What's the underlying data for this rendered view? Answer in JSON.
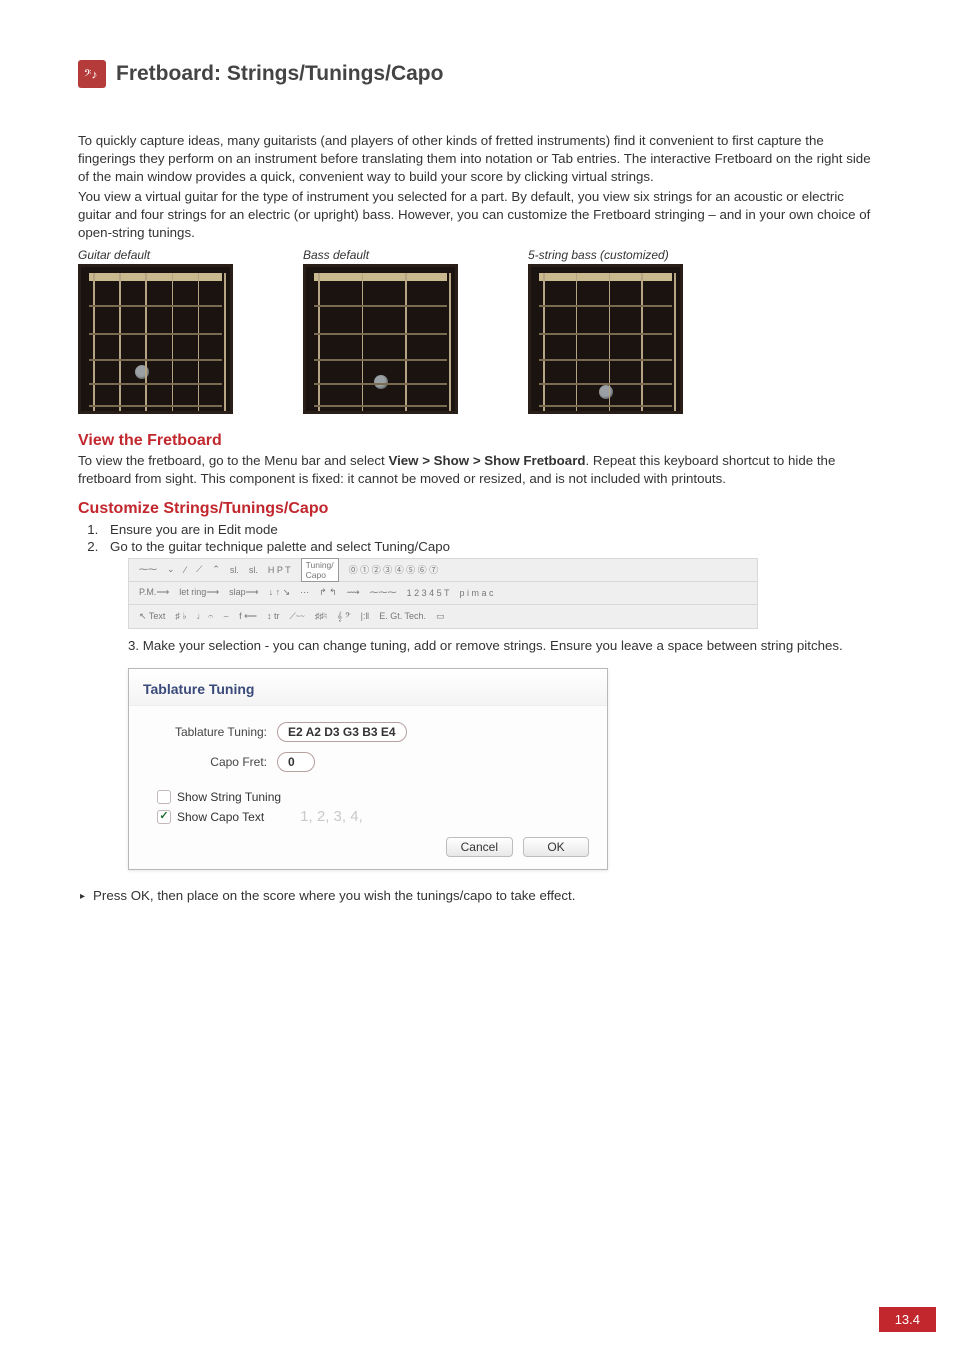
{
  "page": {
    "title": "Fretboard: Strings/Tunings/Capo",
    "number": "13.4"
  },
  "intro": {
    "p1": "To quickly capture ideas, many guitarists (and players of other kinds of fretted instruments) find it convenient to first capture the fingerings they perform on an instrument before translating them into notation or Tab entries. The interactive Fretboard on the right side of the main window provides a quick, convenient way to build your score by clicking virtual strings.",
    "p2": "You view a virtual guitar for the type of instrument you selected for a part. By default, you view six strings for an acoustic or electric guitar and four strings for an electric (or upright) bass. However, you can customize the Fretboard stringing – and in your own choice of open-string tunings."
  },
  "fretboards": {
    "guitar": {
      "caption": "Guitar default",
      "strings": 6
    },
    "bass": {
      "caption": "Bass default",
      "strings": 4
    },
    "five": {
      "caption": "5-string bass (customized)",
      "strings": 5
    }
  },
  "sections": {
    "view_heading": "View the Fretboard",
    "view_text_pre": "To view the fretboard, go to the Menu bar and select ",
    "view_menu": "View > Show > Show Fretboard",
    "view_text_post": ". Repeat this keyboard shortcut to hide the fretboard from sight. This component is fixed: it cannot be moved or resized, and is not included with printouts.",
    "customize_heading": "Customize Strings/Tunings/Capo"
  },
  "steps": {
    "s1": "Ensure you are in Edit mode",
    "s2": "Go to the guitar technique palette and select Tuning/Capo",
    "s3": "3. Make your selection - you can change tuning, add or remove strings. Ensure you leave a space between string pitches."
  },
  "palette": {
    "row1": [
      "⁓⁓",
      "⌄",
      "⁄",
      "⟋",
      "⌃",
      "sl.",
      "sl.",
      "H P T",
      "Tuning/\nCapo",
      "⓪ ① ② ③ ④ ⑤ ⑥ ⑦"
    ],
    "row2": [
      "P.M.⟶",
      "let ring⟶",
      "slap⟶",
      "↓ ↑ ↘",
      "⋯",
      "↱ ↰",
      "⟿",
      "⁓⁓⁓",
      "1 2 3 4 5 T",
      "p i m a c"
    ],
    "row3": [
      "↖ Text",
      "♯ ♭",
      "♩ 𝄐",
      "⌣",
      "f ⟵",
      "↕ tr",
      "⟋⁓⁓",
      "♯♯♮",
      "𝄞 𝄢",
      "|:‖",
      "E. Gt.\nTech.",
      "▭"
    ]
  },
  "dialog": {
    "title": "Tablature Tuning",
    "tuning_label": "Tablature Tuning:",
    "tuning_value": "E2 A2 D3 G3 B3 E4",
    "capo_label": "Capo Fret:",
    "capo_value": "0",
    "show_string_label": "Show String Tuning",
    "show_string_checked": false,
    "show_capo_label": "Show Capo Text",
    "show_capo_checked": true,
    "ghost": "1, 2, 3, 4,",
    "cancel": "Cancel",
    "ok": "OK"
  },
  "final_note": "Press OK, then place on the score where you wish the tunings/capo to take effect."
}
